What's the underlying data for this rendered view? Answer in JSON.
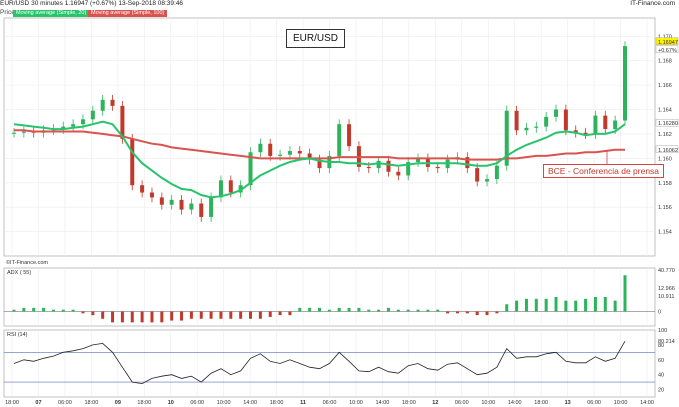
{
  "header": {
    "symbol": "EUR/USD",
    "interval": "30 minutes",
    "last": "1.16947 (+0.67%)",
    "datetime": "13-Sep-2018 08:39:46",
    "site": "IT-Finance.com",
    "price_label": "Price",
    "ma_fast_label": "Moving average (Simple, 20)",
    "ma_slow_label": "Moving average (Simple, 100)",
    "colors": {
      "bull": "#2db35a",
      "bear": "#c0392b",
      "ma_fast": "#27c46b",
      "ma_slow": "#d9534f"
    }
  },
  "panels": {
    "price_title": "EUR/USD",
    "annotation": "BCE - Conferencia de prensa",
    "source_label": "©IT-Finance.com",
    "adx_label": "ADX ( 55)",
    "rsi_label": "RSI (14)"
  },
  "chart_data": [
    {
      "type": "line",
      "title": "EUR/USD",
      "ylim": [
        1.152,
        1.1715
      ],
      "y_ticks": [
        1.154,
        1.156,
        1.158,
        1.16,
        1.162,
        1.164,
        1.166,
        1.168,
        1.17
      ],
      "x_ticks": [
        "18:00",
        "07",
        "06:00",
        "18:00",
        "09",
        "18:00",
        "10",
        "06:00",
        "10:00",
        "14:00",
        "18:00",
        "11",
        "06:00",
        "10:00",
        "14:00",
        "18:00",
        "12",
        "06:00",
        "10:00",
        "14:00",
        "18:00",
        "13",
        "06:00",
        "10:00",
        "14:00"
      ],
      "price_close": [
        1.1621,
        1.1622,
        1.1621,
        1.1623,
        1.1624,
        1.1626,
        1.1628,
        1.1632,
        1.1639,
        1.1648,
        1.1643,
        1.1616,
        1.1578,
        1.1572,
        1.1568,
        1.1562,
        1.1566,
        1.1558,
        1.1563,
        1.1552,
        1.1568,
        1.1582,
        1.1572,
        1.1578,
        1.1605,
        1.1612,
        1.1602,
        1.1603,
        1.1606,
        1.1604,
        1.1599,
        1.1592,
        1.1602,
        1.1628,
        1.161,
        1.1593,
        1.1592,
        1.1598,
        1.1589,
        1.1586,
        1.1597,
        1.16,
        1.1593,
        1.1592,
        1.1599,
        1.1601,
        1.1592,
        1.1581,
        1.1583,
        1.1594,
        1.1639,
        1.1623,
        1.1625,
        1.1626,
        1.1634,
        1.164,
        1.1623,
        1.1621,
        1.162,
        1.1635,
        1.1624,
        1.1631,
        1.1692
      ],
      "ma20": [
        1.1628,
        1.1627,
        1.1626,
        1.1625,
        1.1624,
        1.1624,
        1.1625,
        1.1626,
        1.1628,
        1.163,
        1.1628,
        1.1618,
        1.1605,
        1.1596,
        1.159,
        1.1584,
        1.1579,
        1.1575,
        1.1574,
        1.157,
        1.1568,
        1.1569,
        1.1571,
        1.1574,
        1.158,
        1.1586,
        1.159,
        1.1594,
        1.1597,
        1.1599,
        1.16,
        1.1598,
        1.1597,
        1.1597,
        1.1596,
        1.1596,
        1.1595,
        1.1596,
        1.1595,
        1.1594,
        1.1595,
        1.1596,
        1.1596,
        1.1596,
        1.1596,
        1.1596,
        1.1595,
        1.1594,
        1.1594,
        1.1596,
        1.1602,
        1.1607,
        1.1611,
        1.1614,
        1.1617,
        1.1621,
        1.1622,
        1.1621,
        1.1619,
        1.162,
        1.162,
        1.1622,
        1.1628
      ],
      "ma100": [
        1.1623,
        1.1623,
        1.1622,
        1.1622,
        1.1622,
        1.1622,
        1.1622,
        1.1622,
        1.1621,
        1.162,
        1.1619,
        1.1618,
        1.1616,
        1.1614,
        1.1612,
        1.1611,
        1.1609,
        1.1608,
        1.1607,
        1.1606,
        1.1605,
        1.1604,
        1.1603,
        1.1602,
        1.1601,
        1.16,
        1.16,
        1.16,
        1.16,
        1.16,
        1.16,
        1.16,
        1.16,
        1.1601,
        1.1601,
        1.1601,
        1.1601,
        1.1601,
        1.1601,
        1.16,
        1.16,
        1.16,
        1.16,
        1.16,
        1.16,
        1.16,
        1.1599,
        1.1599,
        1.1599,
        1.1599,
        1.16,
        1.16,
        1.1601,
        1.1602,
        1.1602,
        1.1603,
        1.1604,
        1.1604,
        1.1605,
        1.1605,
        1.1606,
        1.1607,
        1.1607
      ],
      "right_labels": [
        "1.16947",
        "+0.67%",
        "1.16280",
        "1.16062"
      ]
    },
    {
      "type": "bar",
      "title": "ADX ( 55)",
      "ylim": [
        -4,
        12
      ],
      "right_labels": [
        "40.770",
        "12.966",
        "10.911",
        "0"
      ],
      "values": [
        0.5,
        1,
        1,
        1,
        0.5,
        0.5,
        0.5,
        -0.5,
        -1,
        -2,
        -3,
        -3,
        -3,
        -3,
        -3,
        -3,
        -2.5,
        -2.5,
        -2,
        -2,
        -2,
        -2,
        -2,
        -2,
        -2,
        -2,
        -1.5,
        -1,
        -1,
        1,
        1,
        1,
        0.5,
        1,
        1,
        1,
        0.5,
        0.5,
        1,
        0.5,
        0.5,
        0.5,
        0.5,
        0.5,
        -0.5,
        -0.5,
        -0.5,
        -1,
        -1,
        -0.5,
        2,
        3,
        3.5,
        3.5,
        3.5,
        4,
        3,
        3,
        3.5,
        4,
        4,
        3,
        10
      ]
    },
    {
      "type": "line",
      "title": "RSI (14)",
      "ylim": [
        10,
        100
      ],
      "y_ticks": [
        20,
        40,
        60,
        80,
        100
      ],
      "right_labels": [
        "80.214"
      ],
      "values": [
        55,
        60,
        58,
        62,
        65,
        70,
        72,
        75,
        80,
        82,
        70,
        50,
        30,
        28,
        35,
        38,
        40,
        35,
        38,
        30,
        42,
        48,
        40,
        45,
        62,
        68,
        58,
        55,
        60,
        55,
        50,
        48,
        55,
        70,
        58,
        45,
        44,
        50,
        44,
        42,
        52,
        55,
        48,
        46,
        54,
        56,
        48,
        40,
        42,
        50,
        75,
        62,
        64,
        64,
        68,
        70,
        58,
        56,
        56,
        64,
        58,
        62,
        85
      ]
    }
  ]
}
